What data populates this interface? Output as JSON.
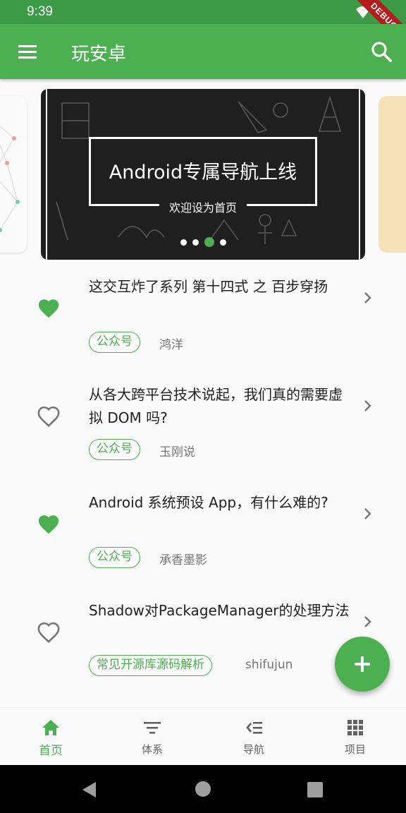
{
  "status_bar": {
    "time": "9:39",
    "debug_label": "DEBUG"
  },
  "app_bar": {
    "title": "玩安卓",
    "menu_icon": "menu-icon",
    "search_icon": "search-icon"
  },
  "banner": {
    "title": "Android专属导航上线",
    "subtitle": "欢迎设为首页",
    "page_count": 4,
    "active_index": 2
  },
  "articles": [
    {
      "title": "这交互炸了系列 第十四式 之 百步穿扬",
      "tag": "公众号",
      "author": "鸿洋",
      "favorited": true
    },
    {
      "title": "从各大跨平台技术说起，我们真的需要虚拟 DOM 吗?",
      "tag": "公众号",
      "author": "玉刚说",
      "favorited": false
    },
    {
      "title": "Android 系统预设 App，有什么难的?",
      "tag": "公众号",
      "author": "承香墨影",
      "favorited": true
    },
    {
      "title": "Shadow对PackageManager的处理方法",
      "tag": "常见开源库源码解析",
      "author": "shifujun",
      "favorited": false
    }
  ],
  "fab": {
    "icon": "add-icon"
  },
  "bottom_nav": [
    {
      "label": "首页",
      "icon": "home-icon",
      "active": true
    },
    {
      "label": "体系",
      "icon": "filter-icon",
      "active": false
    },
    {
      "label": "导航",
      "icon": "navigation-list-icon",
      "active": false
    },
    {
      "label": "项目",
      "icon": "grid-icon",
      "active": false
    }
  ],
  "colors": {
    "primary": "#4caf50",
    "status_bar": "#3d9a46",
    "banner_right_peek": "#f6e2b8"
  }
}
